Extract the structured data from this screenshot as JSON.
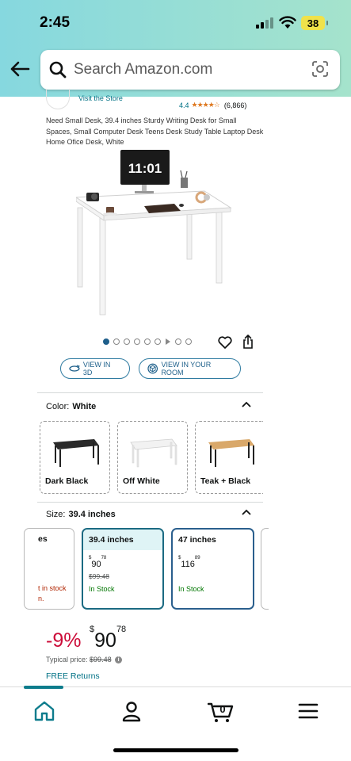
{
  "status": {
    "time": "2:45",
    "battery": "38"
  },
  "search": {
    "placeholder": "Search Amazon.com"
  },
  "product": {
    "store_link": "Visit the Store",
    "rating": "4.4",
    "stars": "★★★★☆",
    "rating_count": "(6,866)",
    "title": "Need Small Desk, 39.4 inches Sturdy Writing Desk for Small Spaces, Small Computer Desk Teens Desk Study Table Laptop Desk Home Ofice Desk, White",
    "image_clock_text": "11:01",
    "carousel_count": 9
  },
  "actions": {
    "view_3d": "VIEW IN 3D",
    "view_room": "VIEW IN YOUR ROOM"
  },
  "color": {
    "label": "Color:",
    "selected": "White",
    "options": [
      {
        "name": "Dark Black",
        "top_color": "#2a2a2a",
        "leg_color": "#222222"
      },
      {
        "name": "Off White",
        "top_color": "#f2f2f2",
        "leg_color": "#e6e6e6"
      },
      {
        "name": "Teak + Black",
        "top_color": "#d9a86a",
        "leg_color": "#222222"
      }
    ]
  },
  "size": {
    "label": "Size:",
    "selected": "39.4 inches",
    "options": [
      {
        "name": "es",
        "stock_line1": "t in stock",
        "stock_line2": "n."
      },
      {
        "name": "39.4 inches",
        "price_whole": "90",
        "price_frac": "78",
        "list_price": "$99.48",
        "stock": "In Stock"
      },
      {
        "name": "47 inches",
        "price_whole": "116",
        "price_frac": "89",
        "stock": "In Stock"
      }
    ]
  },
  "price": {
    "discount": "-9%",
    "currency": "$",
    "whole": "90",
    "fraction": "78",
    "typical_label": "Typical price:",
    "typical_value": "$99.48",
    "free_returns": "FREE Returns"
  },
  "nav": {
    "cart_count": "0"
  },
  "colors": {
    "accent": "#007185",
    "deal_red": "#cc0c39",
    "in_stock": "#007600",
    "header_start": "#86d8df",
    "header_end": "#a5e3cc"
  }
}
